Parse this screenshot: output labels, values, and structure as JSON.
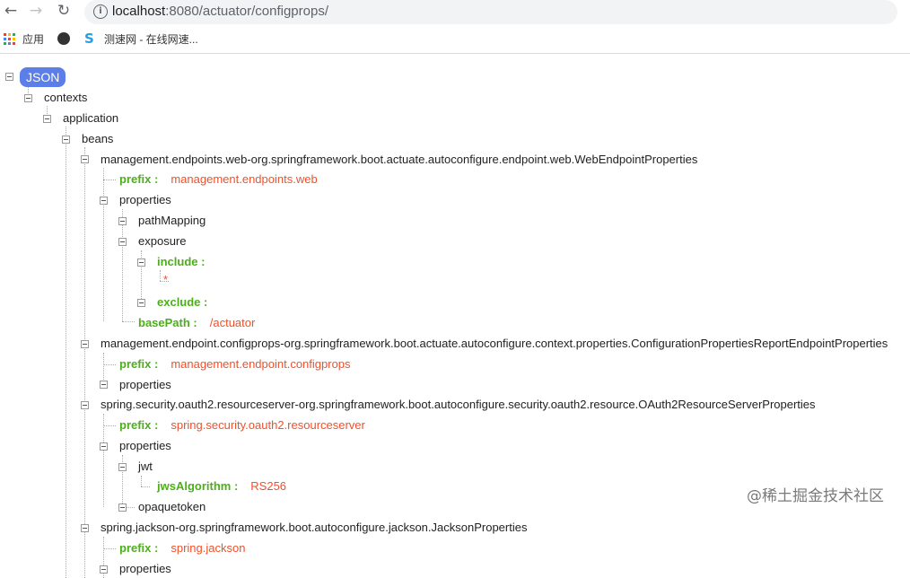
{
  "browser": {
    "back_icon": "back-arrow-icon",
    "forward_icon": "forward-arrow-icon",
    "reload_icon": "reload-icon",
    "url_host": "localhost",
    "url_rest": ":8080/actuator/configprops/",
    "bookmarks": [
      {
        "label": "应用",
        "icon": "apps-grid-icon"
      },
      {
        "label": "",
        "icon": "globe-icon"
      },
      {
        "label": "测速网 - 在线网速...",
        "icon": "speedtest-icon"
      }
    ]
  },
  "tree": {
    "root_label": "JSON",
    "contexts": "contexts",
    "application": "application",
    "beans": "beans",
    "bean1": {
      "name": "management.endpoints.web-org.springframework.boot.actuate.autoconfigure.endpoint.web.WebEndpointProperties",
      "prefix_key": "prefix :",
      "prefix_val": "management.endpoints.web",
      "properties": "properties",
      "pathMapping": "pathMapping",
      "exposure": "exposure",
      "include_key": "include :",
      "include_val": "*",
      "exclude_key": "exclude :",
      "basePath_key": "basePath :",
      "basePath_val": "/actuator"
    },
    "bean2": {
      "name": "management.endpoint.configprops-org.springframework.boot.actuate.autoconfigure.context.properties.ConfigurationPropertiesReportEndpointProperties",
      "prefix_key": "prefix :",
      "prefix_val": "management.endpoint.configprops",
      "properties": "properties"
    },
    "bean3": {
      "name": "spring.security.oauth2.resourceserver-org.springframework.boot.autoconfigure.security.oauth2.resource.OAuth2ResourceServerProperties",
      "prefix_key": "prefix :",
      "prefix_val": "spring.security.oauth2.resourceserver",
      "properties": "properties",
      "jwt": "jwt",
      "jwsAlgorithm_key": "jwsAlgorithm :",
      "jwsAlgorithm_val": "RS256",
      "opaquetoken": "opaquetoken"
    },
    "bean4": {
      "name": "spring.jackson-org.springframework.boot.autoconfigure.jackson.JacksonProperties",
      "prefix_key": "prefix :",
      "prefix_val": "spring.jackson",
      "properties": "properties"
    }
  },
  "watermark": "@稀土掘金技术社区",
  "colors": {
    "badge": "#5b7ee8",
    "key_green": "#4caf1a",
    "value_orange": "#f0502a"
  }
}
